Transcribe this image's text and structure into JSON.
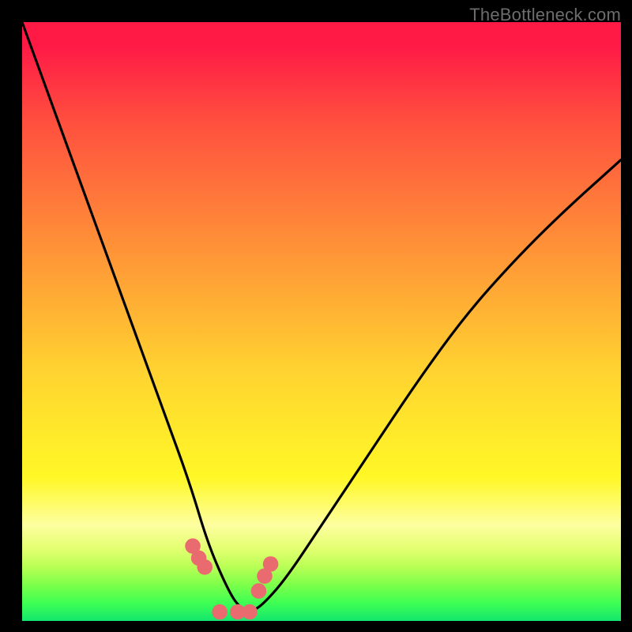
{
  "watermark": "TheBottleneck.com",
  "chart_data": {
    "type": "line",
    "title": "",
    "xlabel": "",
    "ylabel": "",
    "xlim": [
      0,
      100
    ],
    "ylim": [
      0,
      100
    ],
    "series": [
      {
        "name": "bottleneck-curve",
        "x": [
          0,
          4,
          8,
          12,
          16,
          20,
          24,
          28,
          31,
          34,
          36,
          38,
          40,
          44,
          50,
          58,
          66,
          74,
          82,
          90,
          100
        ],
        "values": [
          100,
          89,
          78,
          67,
          56,
          45,
          34,
          23,
          13,
          6,
          2.5,
          1.5,
          2.5,
          7,
          16,
          28,
          40,
          51,
          60,
          68,
          77
        ]
      }
    ],
    "markers": {
      "name": "highlight-dots",
      "x": [
        28.5,
        29.5,
        30.5,
        33,
        36,
        38,
        39.5,
        40.5,
        41.5
      ],
      "values": [
        12.5,
        10.5,
        9,
        1.5,
        1.5,
        1.5,
        5,
        7.5,
        9.5
      ],
      "color": "#e96a6f",
      "size": 9.8
    },
    "annotations": []
  },
  "colors": {
    "curve_stroke": "#000000",
    "marker_fill": "#e96a6f",
    "background_frame": "#000000"
  }
}
